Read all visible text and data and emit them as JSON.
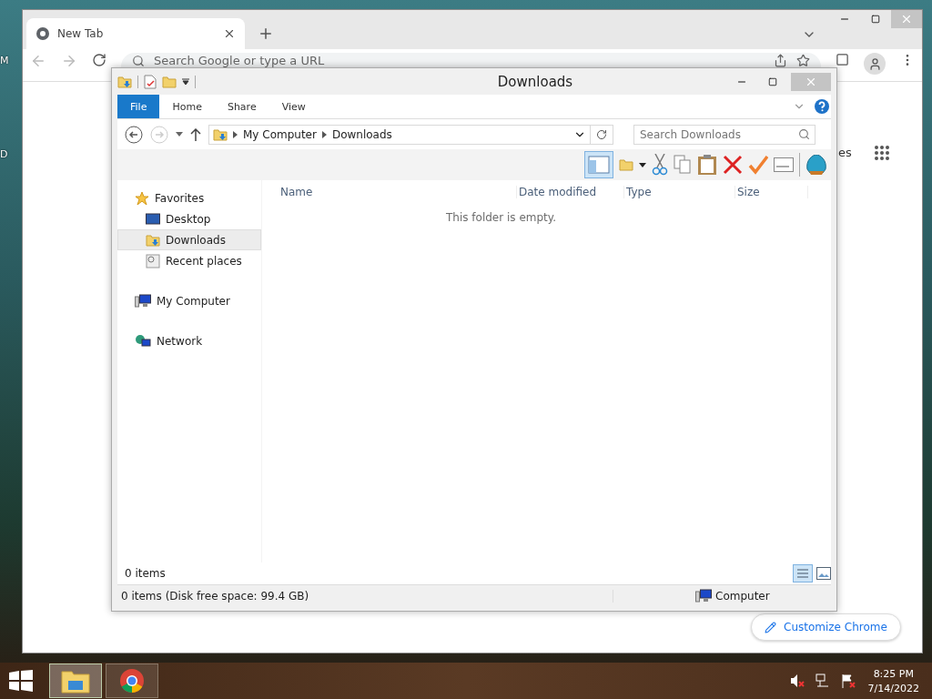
{
  "desktop": {
    "icon_labels": [
      "M",
      "D"
    ]
  },
  "chrome": {
    "tab": {
      "title": "New Tab",
      "selected": true
    },
    "omnibox": {
      "placeholder": "Search Google or type a URL"
    },
    "page": {
      "shortcut_fragment": "es",
      "customize_button": "Customize Chrome"
    }
  },
  "explorer": {
    "title": "Downloads",
    "ribbon_tabs": [
      {
        "label": "File",
        "kind": "file"
      },
      {
        "label": "Home",
        "kind": "tab"
      },
      {
        "label": "Share",
        "kind": "tab"
      },
      {
        "label": "View",
        "kind": "tab"
      }
    ],
    "address": {
      "path": [
        "My Computer",
        "Downloads"
      ]
    },
    "search": {
      "placeholder": "Search Downloads"
    },
    "nav": [
      {
        "label": "Favorites",
        "kind": "star",
        "selected": false,
        "children": [
          {
            "label": "Desktop",
            "kind": "desktop",
            "selected": false
          },
          {
            "label": "Downloads",
            "kind": "downloads",
            "selected": true
          },
          {
            "label": "Recent places",
            "kind": "recent",
            "selected": false
          }
        ]
      },
      {
        "label": "My Computer",
        "kind": "computer",
        "selected": false
      },
      {
        "label": "Network",
        "kind": "network",
        "selected": false
      }
    ],
    "columns": [
      "Name",
      "Date modified",
      "Type",
      "Size"
    ],
    "empty_message": "This folder is empty.",
    "item_count": "0 items",
    "status": {
      "summary": "0 items (Disk free space: 99.4 GB)",
      "location": "Computer"
    }
  },
  "taskbar": {
    "apps": [
      {
        "kind": "explorer",
        "active": true
      },
      {
        "kind": "chrome",
        "active": false
      }
    ],
    "time": "8:25 PM",
    "date": "7/14/2022"
  }
}
